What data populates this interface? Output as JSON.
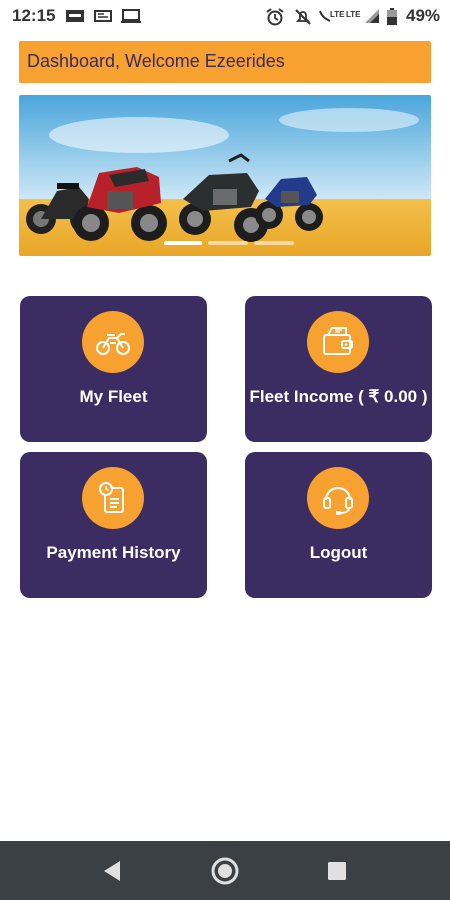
{
  "status_bar": {
    "time": "12:15",
    "battery": "49%",
    "network": "LTE",
    "icons": [
      "sim-icon",
      "cast-icon",
      "laptop-icon",
      "alarm-icon",
      "mute-icon",
      "signal-icon",
      "battery-icon"
    ]
  },
  "header": {
    "title": "Dashboard, Welcome Ezeerides",
    "bg_color": "#f7a230",
    "text_color": "#3c2a63"
  },
  "banner": {
    "slide_count": 3,
    "active_slide": 0
  },
  "tiles": [
    {
      "label": "My Fleet",
      "icon": "motorbike-icon"
    },
    {
      "label": "Fleet Income ( ₹ 0.00 )",
      "icon": "wallet-icon"
    },
    {
      "label": "Payment History",
      "icon": "clock-document-icon"
    },
    {
      "label": "Logout",
      "icon": "headset-icon"
    }
  ],
  "colors": {
    "tile_bg": "#3b2c62",
    "accent": "#f7a230",
    "nav_bg": "#3a4044"
  },
  "nav": {
    "buttons": [
      "back-icon",
      "home-icon",
      "recents-icon"
    ]
  }
}
